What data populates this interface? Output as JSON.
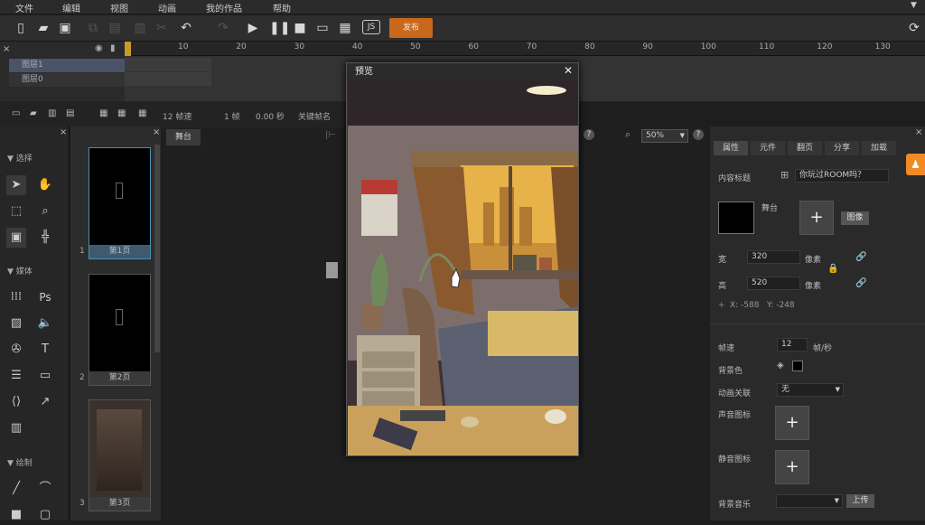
{
  "menu": [
    "文件",
    "编辑",
    "视图",
    "动画",
    "我的作品",
    "帮助"
  ],
  "toolbar": {
    "publish_label": "发布"
  },
  "timeline": {
    "ruler_ticks": [
      "10",
      "20",
      "30",
      "40",
      "50",
      "60",
      "70",
      "80",
      "90",
      "100",
      "110",
      "120",
      "130"
    ],
    "layers": [
      "图层1",
      "图层0"
    ],
    "fps_label": "12 帧速",
    "frame_label": "1 帧",
    "time_label": "0.00 秒",
    "keyframe_label": "关键帧名"
  },
  "left_panel": {
    "select": "选择",
    "media": "媒体",
    "draw": "绘制"
  },
  "pages": [
    {
      "num": "1",
      "label": "第1页"
    },
    {
      "num": "2",
      "label": "第2页"
    },
    {
      "num": "3",
      "label": "第3页"
    }
  ],
  "stage": {
    "tab": "舞台",
    "zoom": "50%"
  },
  "preview": {
    "title": "预览"
  },
  "right_panel": {
    "tabs": [
      "属性",
      "元件",
      "翻页",
      "分享",
      "加载"
    ],
    "content_title_label": "内容标题",
    "content_title_value": "你玩过ROOM吗？",
    "stage_label": "舞台",
    "image_button": "图像",
    "width_label": "宽",
    "width_value": "320",
    "height_label": "高",
    "height_value": "520",
    "unit": "像素",
    "x_label": "X: -588",
    "y_label": "Y: -248",
    "fps_label": "帧速",
    "fps_value": "12",
    "fps_unit": "帧/秒",
    "bg_label": "背景色",
    "anim_label": "动画关联",
    "anim_value": "无",
    "sound_icon_label": "声音图标",
    "mute_icon_label": "静音图标",
    "bgm_label": "背景音乐",
    "upload_label": "上传"
  },
  "colors": {
    "accent": "#c9681c",
    "bg": "#1e1e1e"
  }
}
